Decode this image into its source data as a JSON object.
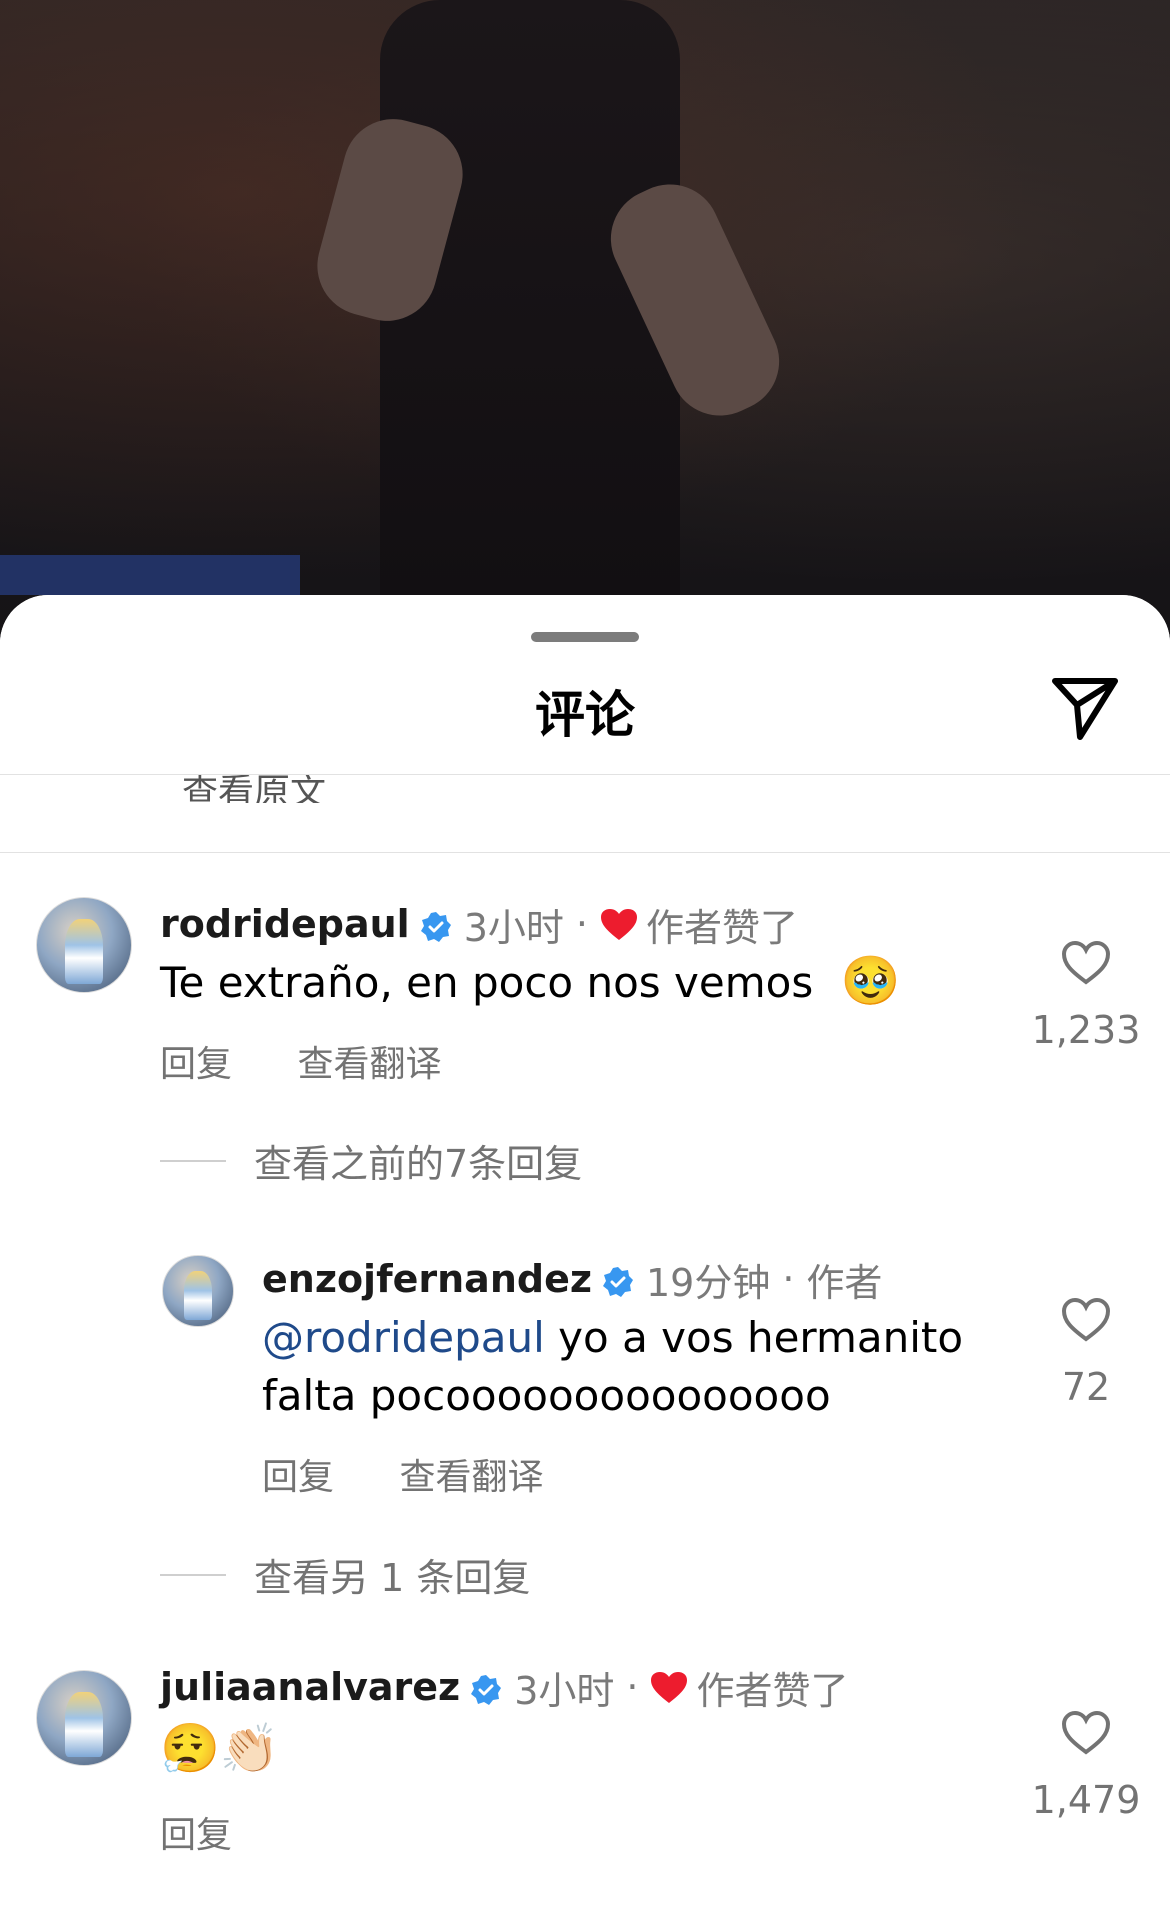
{
  "sheet": {
    "title": "评论",
    "share_icon": "paper-plane-icon",
    "cut_text": "查看原文"
  },
  "comments": [
    {
      "username": "rodridepaul",
      "time": "3小时",
      "liked_by_author": "作者赞了",
      "text": "Te extraño, en poco nos vemos",
      "emoji": "🥹",
      "reply_label": "回复",
      "translate_label": "查看翻译",
      "likes": "1,233",
      "view_replies": "查看之前的7条回复"
    },
    {
      "username": "enzojfernandez",
      "time": "19分钟",
      "author_label": "作者",
      "mention": "@rodridepaul",
      "text_line1": " yo a vos hermanito",
      "text_line2": "falta pocooooooooooooooo",
      "reply_label": "回复",
      "translate_label": "查看翻译",
      "likes": "72",
      "view_more": "查看另 1 条回复"
    },
    {
      "username": "juliaanalvarez",
      "time": "3小时",
      "liked_by_author": "作者赞了",
      "emoji_text": "😮‍💨👏🏻",
      "reply_label": "回复",
      "likes": "1,479"
    }
  ],
  "colors": {
    "verified": "#3897f0",
    "heart_red": "#ed1c2e",
    "mention": "#1f4a8a",
    "muted": "#737373"
  }
}
